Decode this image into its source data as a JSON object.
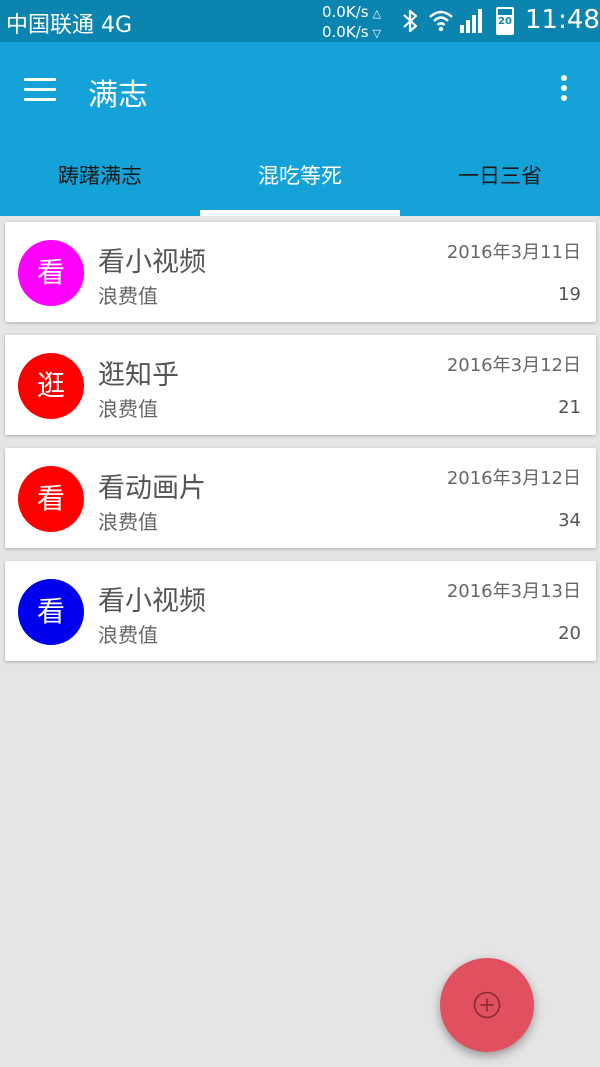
{
  "status_bar": {
    "carrier": "中国联通 4G",
    "upload_speed": "0.0K/s",
    "download_speed": "0.0K/s",
    "upload_arrow": "△",
    "download_arrow": "▽",
    "battery_level": "20",
    "time": "11:48"
  },
  "app_bar": {
    "title": "满志",
    "menu_icon": "hamburger-menu-icon",
    "overflow_icon": "more-vert-icon",
    "color": "#14a2d8"
  },
  "tabs": [
    {
      "label": "踌躇满志",
      "active": false
    },
    {
      "label": "混吃等死",
      "active": true
    },
    {
      "label": "一日三省",
      "active": false
    }
  ],
  "items": [
    {
      "avatar_text": "看",
      "avatar_color": "#ff00ff",
      "title": "看小视频",
      "subtitle": "浪费值",
      "date": "2016年3月11日",
      "value": "19"
    },
    {
      "avatar_text": "逛",
      "avatar_color": "#ff0000",
      "title": "逛知乎",
      "subtitle": "浪费值",
      "date": "2016年3月12日",
      "value": "21"
    },
    {
      "avatar_text": "看",
      "avatar_color": "#ff0000",
      "title": "看动画片",
      "subtitle": "浪费值",
      "date": "2016年3月12日",
      "value": "34"
    },
    {
      "avatar_text": "看",
      "avatar_color": "#0000ee",
      "title": "看小视频",
      "subtitle": "浪费值",
      "date": "2016年3月13日",
      "value": "20"
    }
  ],
  "fab": {
    "icon": "add-circle-icon",
    "color": "#e1505f"
  }
}
